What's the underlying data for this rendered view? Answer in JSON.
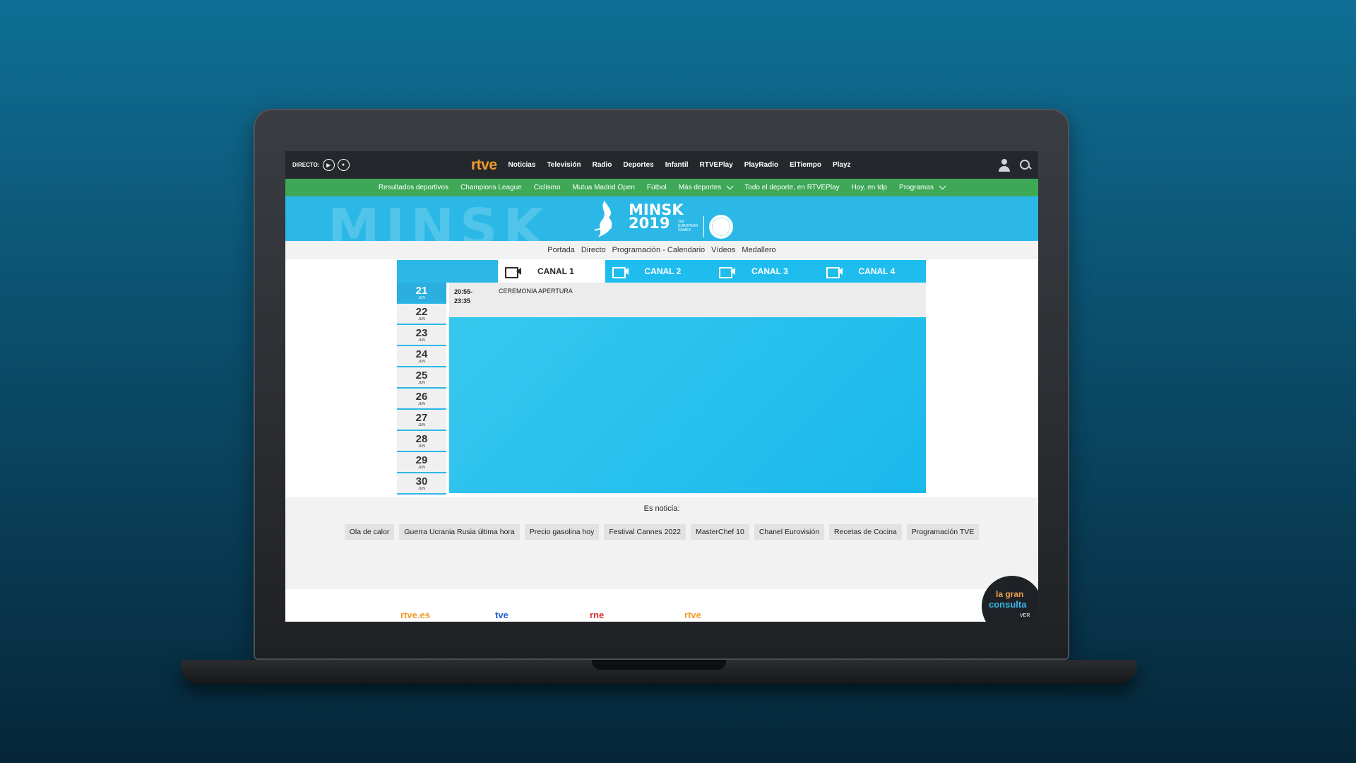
{
  "topbar": {
    "directo_label": "DIRECTO:",
    "logo": "rtve",
    "nav": [
      "Noticias",
      "Televisión",
      "Radio",
      "Deportes",
      "Infantil",
      "RTVEPlay",
      "PlayRadio",
      "ElTiempo",
      "Playz"
    ]
  },
  "greenbar": {
    "items": [
      "Resultados deportivos",
      "Champions League",
      "Ciclismo",
      "Mutua Madrid Open",
      "Fútbol",
      "Más deportes",
      "Todo el deporte, en RTVEPlay",
      "Hoy, en tdp",
      "Programas"
    ]
  },
  "banner": {
    "bg_text": "MINSK",
    "title_line1": "MINSK",
    "title_line2": "2019",
    "sub_line1": "2nd",
    "sub_line2": "EUROPEAN",
    "sub_line3": "GAMES"
  },
  "subnav": [
    "Portada",
    "Directo",
    "Programación - Calendario",
    "Vídeos",
    "Medallero"
  ],
  "schedule": {
    "channels": [
      {
        "label": "CANAL 1",
        "active": true
      },
      {
        "label": "CANAL 2",
        "active": false
      },
      {
        "label": "CANAL 3",
        "active": false
      },
      {
        "label": "CANAL 4",
        "active": false
      }
    ],
    "days": [
      {
        "num": "21",
        "mon": "JUN",
        "selected": true
      },
      {
        "num": "22",
        "mon": "JUN"
      },
      {
        "num": "23",
        "mon": "JUN"
      },
      {
        "num": "24",
        "mon": "JUN"
      },
      {
        "num": "25",
        "mon": "JUN"
      },
      {
        "num": "26",
        "mon": "JUN"
      },
      {
        "num": "27",
        "mon": "JUN"
      },
      {
        "num": "28",
        "mon": "JUN"
      },
      {
        "num": "29",
        "mon": "JUN"
      },
      {
        "num": "30",
        "mon": "JUN"
      }
    ],
    "event": {
      "time_start": "20:55-",
      "time_end": "23:35",
      "title": "CEREMONIA APERTURA"
    }
  },
  "noticia": {
    "title": "Es noticia:",
    "tags": [
      "Ola de calor",
      "Guerra Ucrania Rusia última hora",
      "Precio gasolina hoy",
      "Festival Cannes 2022",
      "MasterChef 10",
      "Chanel Eurovisión",
      "Recetas de Cocina",
      "Programación TVE"
    ]
  },
  "footer": {
    "logos": [
      "rtve.es",
      "tve",
      "rne",
      "rtve"
    ]
  },
  "consulta": {
    "line1": "la gran",
    "line2": "consulta",
    "line3": "VER"
  },
  "colors": {
    "accent_blue": "#2bb8e6",
    "green": "#3ea857",
    "dark_nav": "#24282c",
    "rtve_orange": "#f39b2a"
  }
}
